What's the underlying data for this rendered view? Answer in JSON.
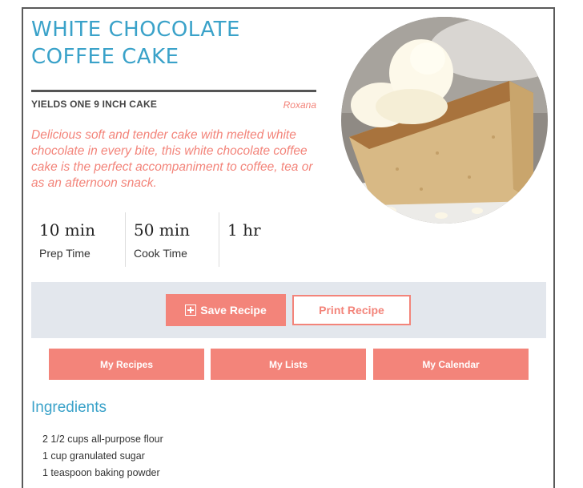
{
  "recipe": {
    "title": "WHITE CHOCOLATE COFFEE CAKE",
    "yields": "YIELDS ONE 9 INCH CAKE",
    "author": "Roxana",
    "summary": "Delicious soft and tender cake with melted white chocolate in every bite, this white chocolate coffee cake is the perfect accompaniment to coffee, tea or as an afternoon snack."
  },
  "times": [
    {
      "value": "10 min",
      "label": "Prep Time"
    },
    {
      "value": "50 min",
      "label": "Cook Time"
    },
    {
      "value": "1 hr",
      "label": ""
    }
  ],
  "actions": {
    "save_label": "Save Recipe",
    "print_label": "Print Recipe"
  },
  "nav": {
    "my_recipes": "My Recipes",
    "my_lists": "My Lists",
    "my_calendar": "My Calendar"
  },
  "ingredients": {
    "heading": "Ingredients",
    "items": [
      "2 1/2 cups all-purpose flour",
      "1 cup granulated sugar",
      "1 teaspoon baking powder"
    ]
  },
  "colors": {
    "accent": "#f3847a",
    "title": "#3aa2c9",
    "band": "#e3e7ed"
  }
}
